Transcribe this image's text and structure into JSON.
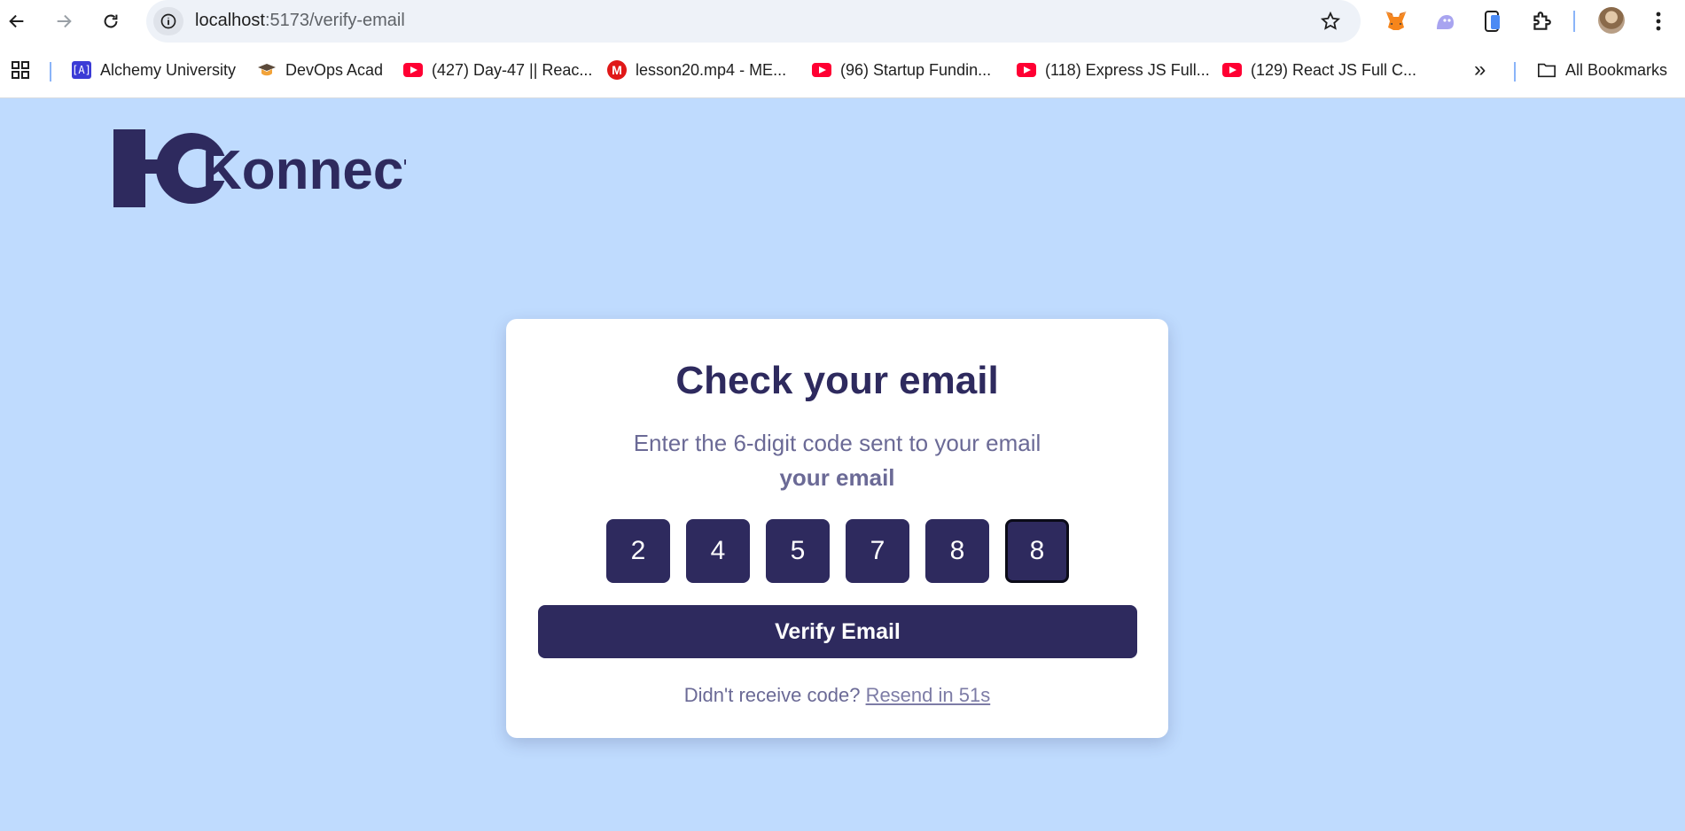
{
  "browser": {
    "url_host": "localhost",
    "url_rest": ":5173/verify-email",
    "bookmarks": [
      {
        "label": "Alchemy University",
        "icon": "alchemy-icon"
      },
      {
        "label": "DevOps Acad",
        "icon": "devops-icon"
      },
      {
        "label": "(427) Day-47 || Reac...",
        "icon": "youtube-icon"
      },
      {
        "label": "lesson20.mp4 - ME...",
        "icon": "mega-icon"
      },
      {
        "label": "(96) Startup Fundin...",
        "icon": "youtube-icon"
      },
      {
        "label": "(118) Express JS Full...",
        "icon": "youtube-icon"
      },
      {
        "label": "(129) React JS Full C...",
        "icon": "youtube-icon"
      }
    ],
    "more_bookmarks": "»",
    "all_bookmarks_label": "All Bookmarks"
  },
  "page": {
    "logo_text": "Konnect",
    "title": "Check your email",
    "subtitle": "Enter the 6-digit code sent to your email",
    "subtitle_strong": "your email",
    "otp_digits": [
      "2",
      "4",
      "5",
      "7",
      "8",
      "8"
    ],
    "verify_label": "Verify Email",
    "resend_prompt": "Didn't receive code?",
    "resend_link": "Resend in 51s"
  },
  "colors": {
    "background": "#bfdbfe",
    "primary": "#2e2a5e",
    "muted_text": "#6b6a96"
  }
}
